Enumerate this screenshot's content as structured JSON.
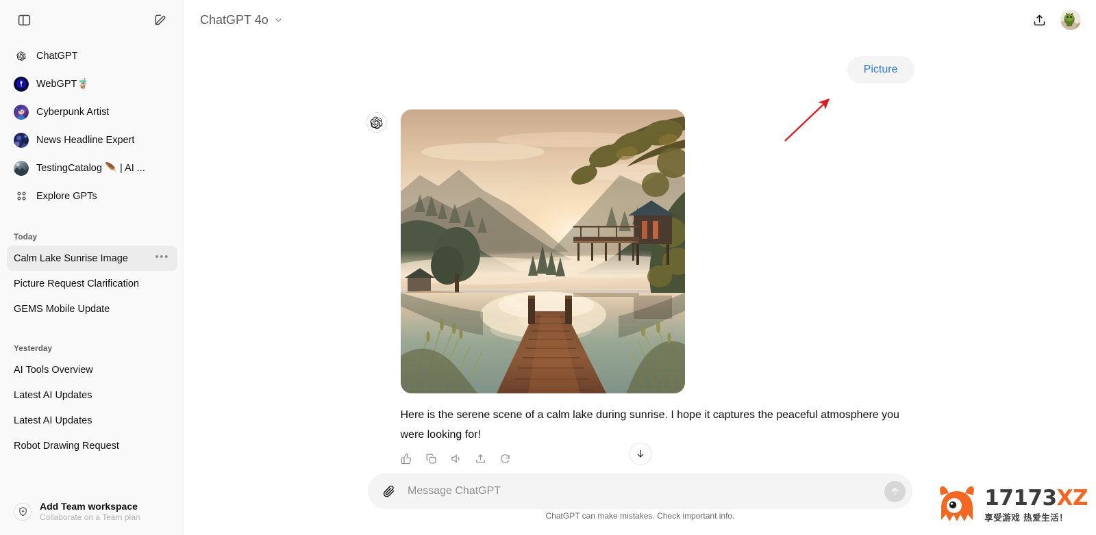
{
  "sidebar": {
    "toggle_icon": "sidebar-panel-icon",
    "new_chat_icon": "compose-pencil-icon",
    "gpts": [
      {
        "label": "ChatGPT",
        "icon": "openai-logo-icon"
      },
      {
        "label": "WebGPT🧋",
        "icon": "webgpt-avatar"
      },
      {
        "label": "Cyberpunk Artist",
        "icon": "cyberpunk-artist-avatar"
      },
      {
        "label": "News Headline Expert",
        "icon": "news-headline-expert-avatar"
      },
      {
        "label": "TestingCatalog 🪶 | AI ...",
        "icon": "testingcatalog-avatar"
      },
      {
        "label": "Explore GPTs",
        "icon": "grid-squares-icon"
      }
    ],
    "groups": [
      {
        "title": "Today",
        "items": [
          {
            "title": "Calm Lake Sunrise Image",
            "active": true,
            "menu": "•••"
          },
          {
            "title": "Picture Request Clarification",
            "active": false
          },
          {
            "title": "GEMS Mobile Update",
            "active": false
          }
        ]
      },
      {
        "title": "Yesterday",
        "items": [
          {
            "title": "AI Tools Overview",
            "active": false
          },
          {
            "title": "Latest AI Updates",
            "active": false
          },
          {
            "title": "Latest AI Updates",
            "active": false
          },
          {
            "title": "Robot Drawing Request",
            "active": false
          }
        ]
      }
    ],
    "team": {
      "title": "Add Team workspace",
      "subtitle": "Collaborate on a Team plan",
      "icon": "team-badge-icon"
    }
  },
  "header": {
    "model_name": "ChatGPT 4o",
    "chevron_icon": "chevron-down-icon",
    "share_icon": "share-upload-icon",
    "avatar_icon": "user-avatar"
  },
  "conversation": {
    "user_message": "Picture",
    "assistant": {
      "avatar_icon": "openai-logo-icon",
      "image_alt": "Calm lake at sunrise with wooden dock, misty forest and boathouse",
      "text": "Here is the serene scene of a calm lake during sunrise. I hope it captures the peaceful atmosphere you were looking for!",
      "actions": [
        {
          "name": "thumbs-up-icon"
        },
        {
          "name": "copy-icon"
        },
        {
          "name": "speaker-icon"
        },
        {
          "name": "share-icon"
        },
        {
          "name": "regenerate-icon"
        }
      ]
    },
    "scroll_button_icon": "arrow-down-icon"
  },
  "composer": {
    "attach_icon": "paperclip-icon",
    "placeholder": "Message ChatGPT",
    "value": "",
    "send_icon": "arrow-up-send-icon"
  },
  "footer": {
    "note": "ChatGPT can make mistakes. Check important info."
  },
  "annotation": {
    "arrow_color": "#d81f1f",
    "icon": "red-pointer-arrow"
  },
  "watermark": {
    "logo_icon": "monster-mascot-logo",
    "main_text_dark": "17173",
    "main_text_orange": "XZ",
    "sub_text": "享受游戏  热爱生活！",
    "color_orange": "#f26722",
    "color_dark": "#3c3c3c"
  },
  "colors": {
    "sidebar_bg": "#f9f9f9",
    "main_bg": "#ffffff",
    "bubble_bg": "#f4f4f4",
    "user_text": "#2e7ed0",
    "active_row": "#ececec"
  }
}
